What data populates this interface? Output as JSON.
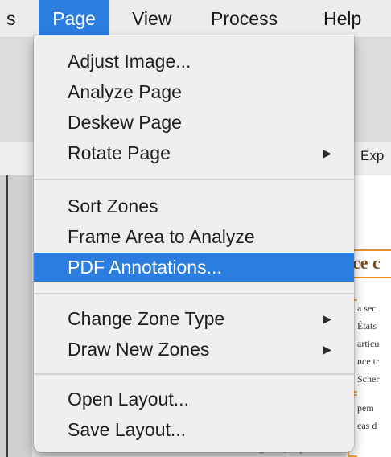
{
  "menubar": {
    "items": [
      {
        "label": "s",
        "active": false
      },
      {
        "label": "Page",
        "active": true
      },
      {
        "label": "View",
        "active": false
      },
      {
        "label": "Process",
        "active": false
      },
      {
        "label": "Help",
        "active": false
      }
    ]
  },
  "dropdown": {
    "groups": [
      [
        {
          "label": "Adjust Image...",
          "submenu": false,
          "highlighted": false
        },
        {
          "label": "Analyze Page",
          "submenu": false,
          "highlighted": false
        },
        {
          "label": "Deskew Page",
          "submenu": false,
          "highlighted": false
        },
        {
          "label": "Rotate Page",
          "submenu": true,
          "highlighted": false
        }
      ],
      [
        {
          "label": "Sort Zones",
          "submenu": false,
          "highlighted": false
        },
        {
          "label": "Frame Area to Analyze",
          "submenu": false,
          "highlighted": false
        },
        {
          "label": "PDF Annotations...",
          "submenu": false,
          "highlighted": true
        }
      ],
      [
        {
          "label": "Change Zone Type",
          "submenu": true,
          "highlighted": false
        },
        {
          "label": "Draw New Zones",
          "submenu": true,
          "highlighted": false
        }
      ],
      [
        {
          "label": "Open Layout...",
          "submenu": false,
          "highlighted": false
        },
        {
          "label": "Save Layout...",
          "submenu": false,
          "highlighted": false
        }
      ]
    ],
    "submenu_glyph": "▶"
  },
  "background": {
    "toolbar_partial": "Exp",
    "doc_heading_partial": "ce c",
    "doc_lines": [
      "a sec",
      "États",
      "articu",
      "nce tr",
      "Scher",
      "",
      "pem",
      "cas d",
      "graves, se poursuiv"
    ]
  },
  "colors": {
    "highlight": "#2b7de0",
    "menu_bg": "#efefef",
    "zone_orange": "#f0a840"
  }
}
